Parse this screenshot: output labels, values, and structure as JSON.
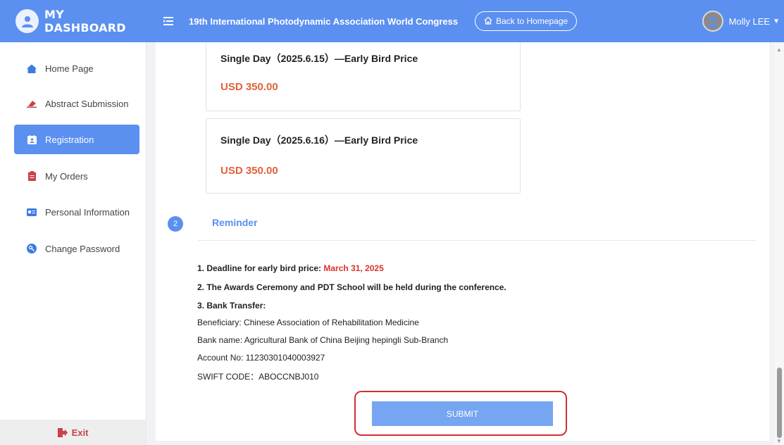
{
  "header": {
    "brand": "MY DASHBOARD",
    "conference_title": "19th International Photodynamic Association World Congress",
    "back_button": "Back to Homepage",
    "user_name": "Molly LEE"
  },
  "sidebar": {
    "items": [
      {
        "label": "Home Page",
        "icon": "home-icon"
      },
      {
        "label": "Abstract Submission",
        "icon": "eraser-icon"
      },
      {
        "label": "Registration",
        "icon": "registration-icon"
      },
      {
        "label": "My Orders",
        "icon": "clipboard-icon"
      },
      {
        "label": "Personal Information",
        "icon": "id-card-icon"
      },
      {
        "label": "Change Password",
        "icon": "key-icon"
      }
    ],
    "active_index": 2,
    "exit_label": "Exit"
  },
  "prices": [
    {
      "title": "Single Day（2025.6.15）—Early Bird Price",
      "amount": "USD 350.00"
    },
    {
      "title": "Single Day（2025.6.16）—Early Bird Price",
      "amount": "USD 350.00"
    }
  ],
  "reminder": {
    "step": "2",
    "title": "Reminder",
    "deadline_label": "1. Deadline for early bird price: ",
    "deadline_date": "March 31, 2025",
    "awards": "2. The Awards Ceremony and PDT School will be held during the conference.",
    "bank_transfer": "3. Bank Transfer:",
    "beneficiary": "Beneficiary: Chinese Association of Rehabilitation Medicine",
    "bank_name": "Bank name: Agricultural Bank of China Beijing hepingli Sub-Branch",
    "account": "Account No:  11230301040003927",
    "swift": "SWIFT CODE：ABOCCNBJ010"
  },
  "submit_label": "SUBMIT",
  "colors": {
    "primary": "#5b8ff0",
    "price": "#e0613a",
    "highlight": "#d9322b",
    "outline": "#d32f2f",
    "submit": "#76a5f2"
  }
}
